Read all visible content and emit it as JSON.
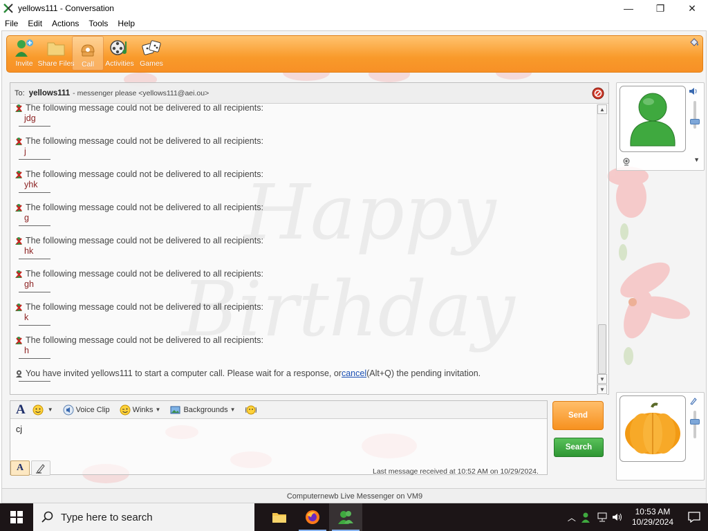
{
  "window": {
    "title": "yellows111 - Conversation",
    "controls": [
      "—",
      "❐",
      "✕"
    ]
  },
  "menu": [
    "File",
    "Edit",
    "Actions",
    "Tools",
    "Help"
  ],
  "toolbar": {
    "items": [
      {
        "label": "Invite",
        "icon": "invite-icon"
      },
      {
        "label": "Share Files",
        "icon": "folder-icon"
      },
      {
        "label": "Call",
        "icon": "phone-icon",
        "active": true
      },
      {
        "label": "Activities",
        "icon": "activities-icon"
      },
      {
        "label": "Games",
        "icon": "games-icon"
      }
    ]
  },
  "to_bar": {
    "label": "To:",
    "name": "yellows111",
    "status": "- messenger please <yellows111@aei.ou>"
  },
  "messages": [
    {
      "type": "error",
      "text": "The following message could not be delivered to all recipients:",
      "body": "jdg"
    },
    {
      "type": "error",
      "text": "The following message could not be delivered to all recipients:",
      "body": "j"
    },
    {
      "type": "error",
      "text": "The following message could not be delivered to all recipients:",
      "body": "yhk"
    },
    {
      "type": "error",
      "text": "The following message could not be delivered to all recipients:",
      "body": "g"
    },
    {
      "type": "error",
      "text": "The following message could not be delivered to all recipients:",
      "body": "hk"
    },
    {
      "type": "error",
      "text": "The following message could not be delivered to all recipients:",
      "body": "gh"
    },
    {
      "type": "error",
      "text": "The following message could not be delivered to all recipients:",
      "body": "k"
    },
    {
      "type": "error",
      "text": "The following message could not be delivered to all recipients:",
      "body": "h"
    }
  ],
  "call_notice": {
    "prefix": "You have invited yellows111 to start a computer call. Please wait for a response, or ",
    "link": "cancel",
    "suffix": " (Alt+Q) the pending invitation."
  },
  "compose": {
    "font_label": "A",
    "voice_clip": "Voice Clip",
    "winks": "Winks",
    "backgrounds": "Backgrounds",
    "input_value": "cj"
  },
  "buttons": {
    "send": "Send",
    "search": "Search"
  },
  "last_message": "Last message received at 10:52 AM on 10/29/2024.",
  "status_bar": "Computernewb Live Messenger on VM9",
  "background": {
    "text_line1": "Happy",
    "text_line2": "Birthday"
  },
  "taskbar": {
    "search_placeholder": "Type here to search",
    "time": "10:53 AM",
    "date": "10/29/2024"
  },
  "colors": {
    "accent_orange": "#f7911f",
    "search_green": "#2e9633",
    "error_body": "#8a1f1f",
    "link": "#1a4fb3"
  }
}
